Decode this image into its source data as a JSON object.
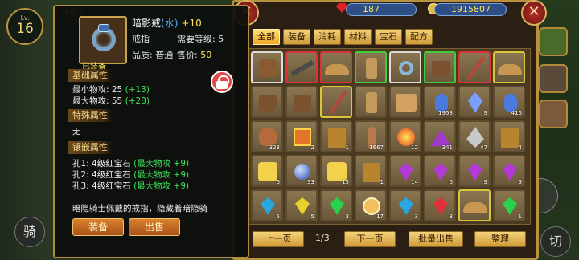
{
  "hud": {
    "level_caption": "Lv.",
    "level": "16",
    "ride_label": "骑",
    "cut_label": "切",
    "bg_tab": "背包"
  },
  "currency": {
    "gems": "187",
    "coins": "1915807"
  },
  "tooltip": {
    "name": "暗影戒",
    "element": "(水)",
    "enhance": "+10",
    "type": "戒指",
    "req_label": "需要等级: 5",
    "quality": "品质: 普通",
    "price_label": "售价:",
    "price": "50",
    "equipped": "已装备",
    "sections": {
      "base": "基础属性",
      "special": "特殊属性",
      "inlay": "镶嵌属性"
    },
    "base_lines": [
      {
        "text": "最小物攻: 25",
        "bonus": "(+13)"
      },
      {
        "text": "最大物攻: 55",
        "bonus": "(+28)"
      }
    ],
    "special_none": "无",
    "inlay_lines": [
      {
        "text": "孔1: 4级红宝石",
        "bonus": "(最大物攻 +9)"
      },
      {
        "text": "孔2: 4级红宝石",
        "bonus": "(最大物攻 +9)"
      },
      {
        "text": "孔3: 4级红宝石",
        "bonus": "(最大物攻 +9)"
      }
    ],
    "description": "暗隐骑士佩戴的戒指，隐藏着暗隐骑",
    "equip_button": "装备",
    "sell_button": "出售"
  },
  "bag": {
    "tabs": [
      "全部",
      "装备",
      "消耗",
      "材料",
      "宝石",
      "配方"
    ],
    "active_tab": "全部",
    "page": "1/3",
    "prev": "上一页",
    "next": "下一页",
    "bulk_sell": "批量出售",
    "sort": "整理",
    "items": [
      {
        "icon": "vest",
        "quality": "white",
        "count": ""
      },
      {
        "icon": "gun",
        "quality": "red",
        "count": ""
      },
      {
        "icon": "hat",
        "quality": "red",
        "count": ""
      },
      {
        "icon": "greave",
        "quality": "green",
        "count": ""
      },
      {
        "icon": "ring",
        "quality": "white",
        "count": ""
      },
      {
        "icon": "boot",
        "quality": "green",
        "count": ""
      },
      {
        "icon": "staff",
        "quality": "red",
        "count": ""
      },
      {
        "icon": "hat",
        "quality": "yellow",
        "count": ""
      },
      {
        "icon": "boot",
        "quality": "none",
        "count": ""
      },
      {
        "icon": "boot",
        "quality": "none",
        "count": ""
      },
      {
        "icon": "staff",
        "quality": "yellow",
        "count": ""
      },
      {
        "icon": "greave",
        "quality": "none",
        "count": ""
      },
      {
        "icon": "scroll",
        "quality": "none",
        "count": ""
      },
      {
        "icon": "potion",
        "quality": "none",
        "count": "1958"
      },
      {
        "icon": "crystal",
        "quality": "none",
        "count": "9"
      },
      {
        "icon": "potion",
        "quality": "none",
        "count": "416"
      },
      {
        "icon": "bag",
        "quality": "none",
        "count": "323"
      },
      {
        "icon": "gift",
        "quality": "none",
        "count": "2"
      },
      {
        "icon": "book",
        "quality": "none",
        "count": "1"
      },
      {
        "icon": "tube",
        "quality": "none",
        "count": "1667"
      },
      {
        "icon": "fire",
        "quality": "none",
        "count": "12"
      },
      {
        "icon": "pyramid",
        "quality": "none",
        "count": "341"
      },
      {
        "icon": "shard",
        "quality": "none",
        "count": "47"
      },
      {
        "icon": "book",
        "quality": "none",
        "count": "4"
      },
      {
        "icon": "puzzle",
        "quality": "none",
        "count": "6"
      },
      {
        "icon": "orb",
        "quality": "none",
        "count": "33"
      },
      {
        "icon": "puzzle",
        "quality": "none",
        "count": "15"
      },
      {
        "icon": "book",
        "quality": "none",
        "count": "1"
      },
      {
        "icon": "gem-purple",
        "quality": "none",
        "count": "14"
      },
      {
        "icon": "gem-purple",
        "quality": "none",
        "count": "6"
      },
      {
        "icon": "gem-purple",
        "quality": "none",
        "count": "9"
      },
      {
        "icon": "gem-purple",
        "quality": "none",
        "count": "9"
      },
      {
        "icon": "gem-blue",
        "quality": "none",
        "count": "5"
      },
      {
        "icon": "gem-yellow",
        "quality": "none",
        "count": "5"
      },
      {
        "icon": "gem-green",
        "quality": "none",
        "count": "3"
      },
      {
        "icon": "medal",
        "quality": "none",
        "count": "17"
      },
      {
        "icon": "gem-blue",
        "quality": "none",
        "count": "3"
      },
      {
        "icon": "gem-red",
        "quality": "none",
        "count": "3"
      },
      {
        "icon": "hat",
        "quality": "yellow",
        "count": ""
      },
      {
        "icon": "gem-green",
        "quality": "none",
        "count": "1"
      }
    ]
  },
  "colors": {
    "accent": "#f0a624",
    "bonus": "#3fe05a",
    "element": "#5aa8ff",
    "enhance": "#ffe25a",
    "panel_border": "#b8923f"
  }
}
